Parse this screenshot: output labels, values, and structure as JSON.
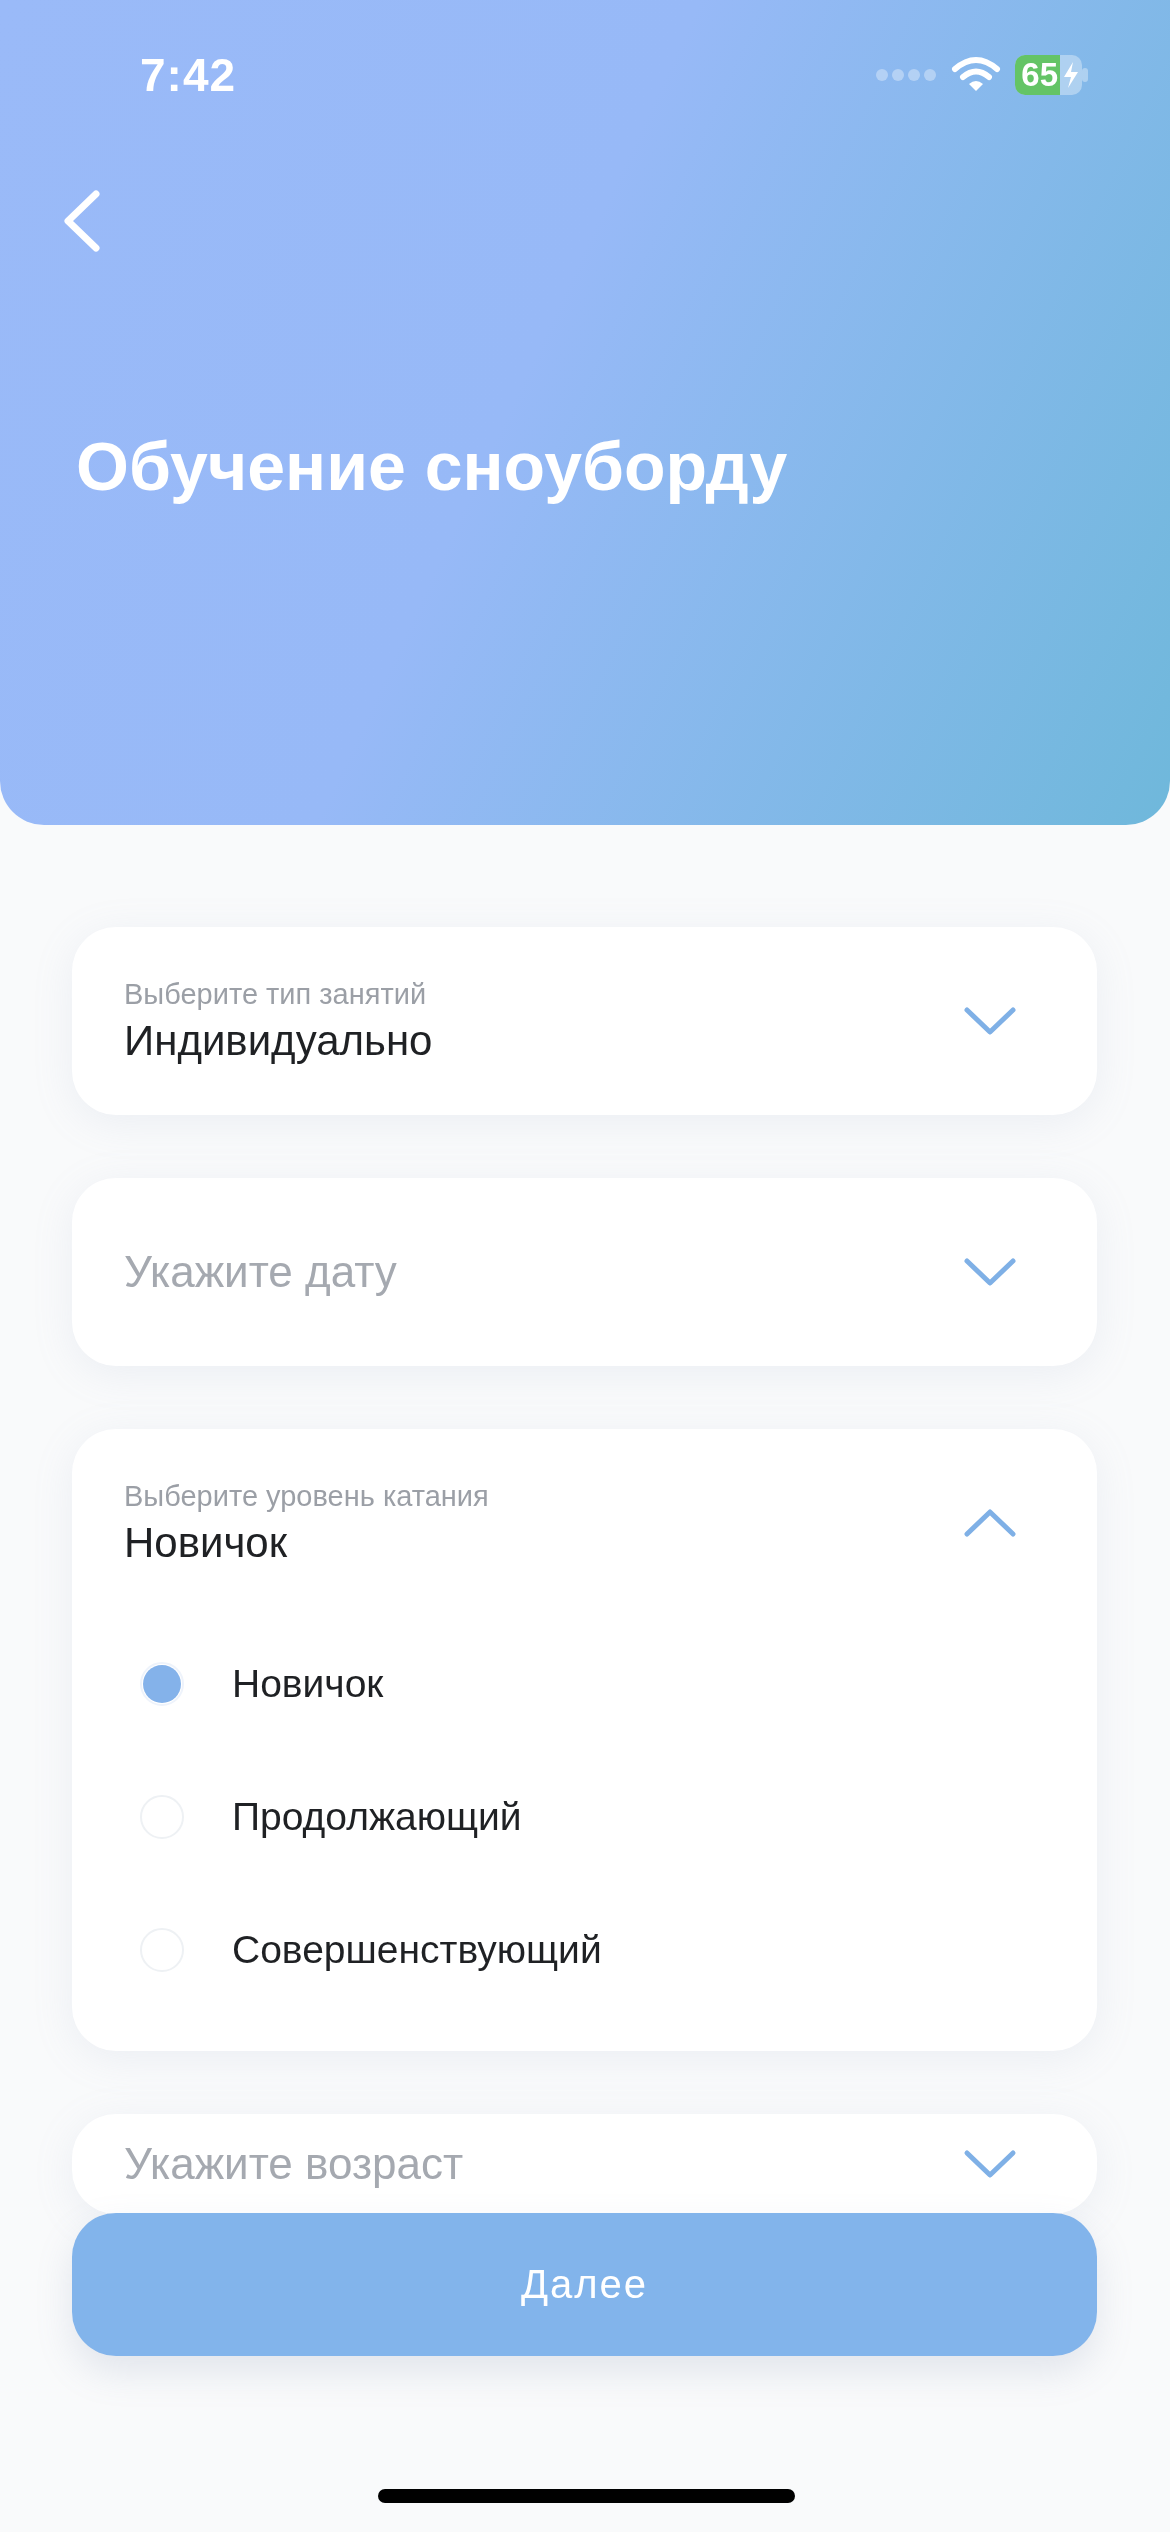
{
  "status_bar": {
    "time": "7:42",
    "battery": "65"
  },
  "header": {
    "title": "Обучение сноуборду"
  },
  "fields": [
    {
      "label": "Выберите тип занятий",
      "value": "Индивидуально",
      "expanded": false
    },
    {
      "placeholder": "Укажите дату",
      "expanded": false
    },
    {
      "label": "Выберите уровень катания",
      "value": "Новичок",
      "expanded": true,
      "options": [
        {
          "label": "Новичок",
          "selected": true
        },
        {
          "label": "Продолжающий",
          "selected": false
        },
        {
          "label": "Совершенствующий",
          "selected": false
        }
      ]
    },
    {
      "placeholder": "Укажите возраст",
      "expanded": false
    }
  ],
  "button": {
    "label": "Далее"
  }
}
